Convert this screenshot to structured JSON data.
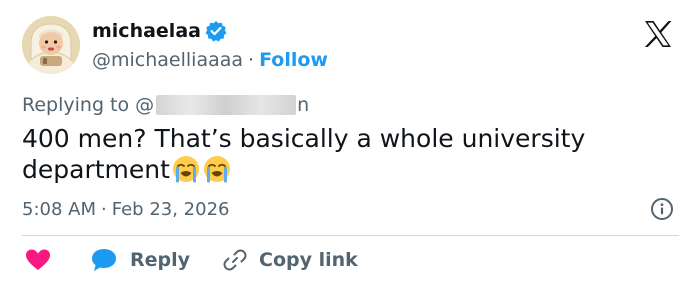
{
  "author": {
    "display_name": "michaelaa",
    "handle": "@michaelliaaaa",
    "separator": "·",
    "follow_label": "Follow"
  },
  "reply": {
    "prefix": "Replying to @",
    "suffix": "n"
  },
  "tweet": {
    "text": "400 men? That’s basically a whole university department"
  },
  "meta": {
    "time": "5:08 AM",
    "separator": "·",
    "date": "Feb 23, 2026"
  },
  "actions": {
    "reply_label": "Reply",
    "copy_link_label": "Copy link"
  },
  "icons": {
    "verified": "verified-badge-icon",
    "logo": "x-logo-icon",
    "info": "info-icon",
    "like": "heart-icon",
    "reply": "speech-bubble-icon",
    "copy": "link-icon",
    "emoji": "loudly-crying-face-emoji"
  },
  "colors": {
    "accent": "#1d9bf0",
    "like": "#f91880",
    "text_primary": "#0f1419",
    "text_secondary": "#536471",
    "divider": "#cfd9de"
  }
}
